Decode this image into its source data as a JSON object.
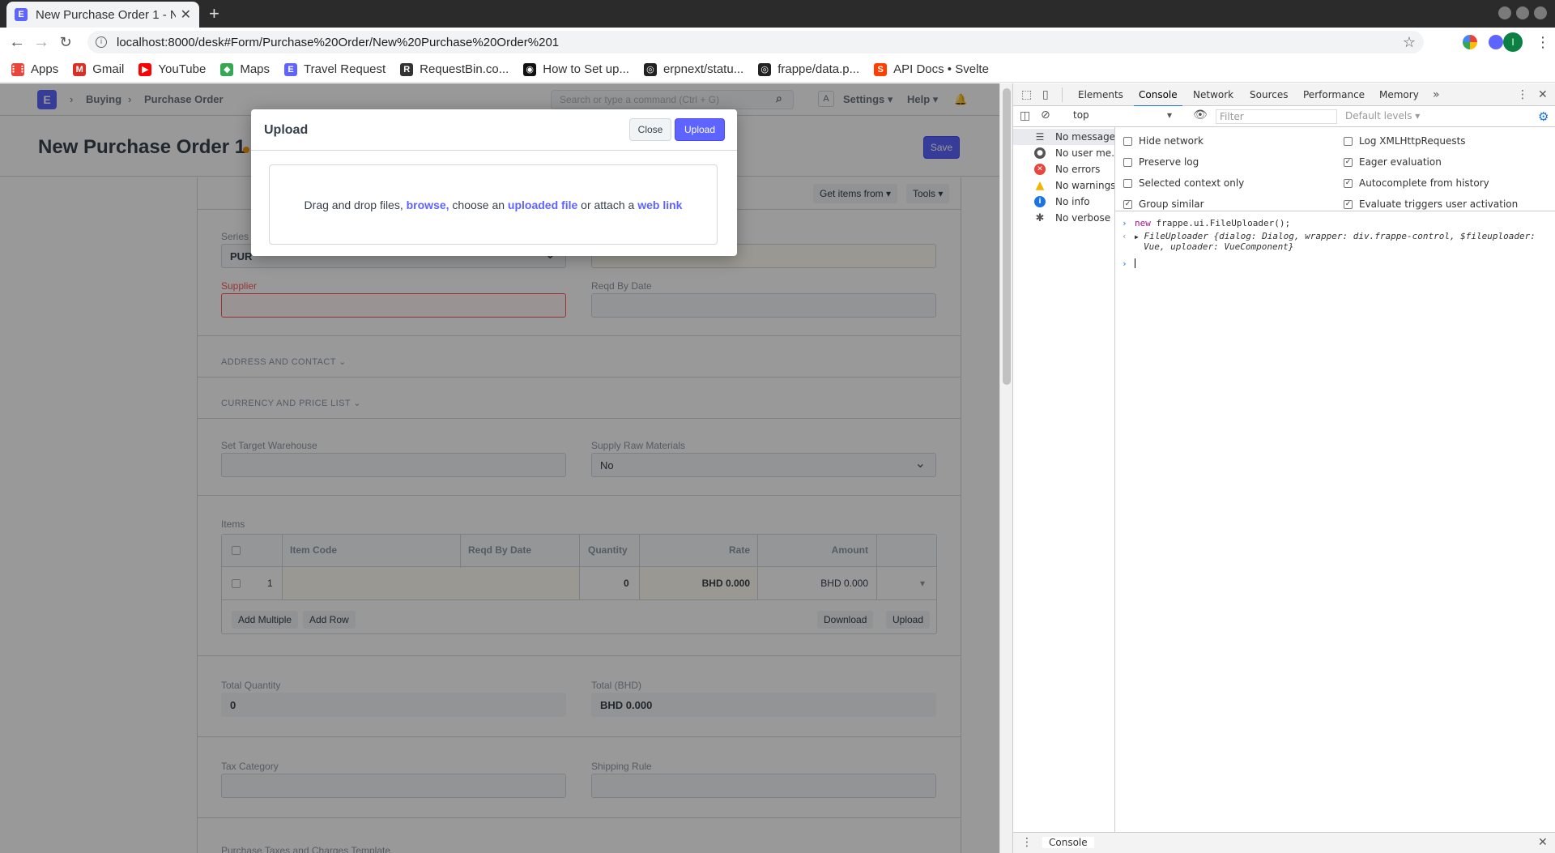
{
  "browser": {
    "tab_title": "New Purchase Order 1 - N",
    "favicon_letter": "E",
    "url": "localhost:8000/desk#Form/Purchase%20Order/New%20Purchase%20Order%201",
    "profile_initial": "I",
    "bookmarks": [
      {
        "label": "Apps",
        "icon": "apps-grid-icon",
        "color": "#e8453c"
      },
      {
        "label": "Gmail",
        "icon": "gmail-icon",
        "color": "#d93025"
      },
      {
        "label": "YouTube",
        "icon": "youtube-icon",
        "color": "#ff0000"
      },
      {
        "label": "Maps",
        "icon": "maps-icon",
        "color": "#34a853"
      },
      {
        "label": "Travel Request",
        "icon": "frappe-icon",
        "color": "#5e64ff"
      },
      {
        "label": "RequestBin.co...",
        "icon": "requestbin-icon",
        "color": "#333333"
      },
      {
        "label": "How to Set up...",
        "icon": "site-icon",
        "color": "#111111"
      },
      {
        "label": "erpnext/statu...",
        "icon": "github-icon",
        "color": "#222222"
      },
      {
        "label": "frappe/data.p...",
        "icon": "github-icon",
        "color": "#222222"
      },
      {
        "label": "API Docs • Svelte",
        "icon": "svelte-icon",
        "color": "#ff3e00"
      }
    ]
  },
  "app": {
    "logo_letter": "E",
    "breadcrumbs": [
      "Buying",
      "Purchase Order"
    ],
    "search_placeholder": "Search or type a command (Ctrl + G)",
    "avatar_letter": "A",
    "settings_label": "Settings",
    "help_label": "Help",
    "page_title": "New Purchase Order 1",
    "save_label": "Save",
    "toolbar": {
      "get_items": "Get items from",
      "tools": "Tools"
    }
  },
  "form": {
    "series_label": "Series",
    "series_value": "PUR",
    "supplier_label": "Supplier",
    "reqd_by_date_label": "Reqd By Date",
    "address_section": "ADDRESS AND CONTACT",
    "currency_section": "CURRENCY AND PRICE LIST",
    "target_warehouse_label": "Set Target Warehouse",
    "supply_raw_label": "Supply Raw Materials",
    "supply_raw_value": "No",
    "items_label": "Items",
    "items_columns": [
      "Item Code",
      "Reqd By Date",
      "Quantity",
      "Rate",
      "Amount"
    ],
    "items_row": {
      "idx": "1",
      "quantity": "0",
      "rate": "BHD 0.000",
      "amount": "BHD 0.000"
    },
    "items_buttons": {
      "add_multiple": "Add Multiple",
      "add_row": "Add Row",
      "download": "Download",
      "upload": "Upload"
    },
    "total_qty_label": "Total Quantity",
    "total_qty_value": "0",
    "total_label": "Total (BHD)",
    "total_value": "BHD 0.000",
    "tax_category_label": "Tax Category",
    "shipping_rule_label": "Shipping Rule",
    "taxes_template_label": "Purchase Taxes and Charges Template"
  },
  "dialog": {
    "title": "Upload",
    "close_label": "Close",
    "upload_label": "Upload",
    "drop_text_1": "Drag and drop files, ",
    "browse": "browse,",
    "drop_text_2": " choose an ",
    "uploaded_file": "uploaded file",
    "drop_text_3": " or attach a ",
    "web_link": "web link"
  },
  "devtools": {
    "tabs": [
      "Elements",
      "Console",
      "Network",
      "Sources",
      "Performance",
      "Memory"
    ],
    "active_tab": "Console",
    "context": "top",
    "filter_placeholder": "Filter",
    "levels": "Default levels",
    "sidebar": [
      {
        "label": "No messages",
        "icon": "list-icon"
      },
      {
        "label": "No user me...",
        "icon": "user-icon"
      },
      {
        "label": "No errors",
        "icon": "error-icon"
      },
      {
        "label": "No warnings",
        "icon": "warning-icon"
      },
      {
        "label": "No info",
        "icon": "info-icon"
      },
      {
        "label": "No verbose",
        "icon": "bug-icon"
      }
    ],
    "options_left": [
      {
        "label": "Hide network",
        "checked": false
      },
      {
        "label": "Preserve log",
        "checked": false
      },
      {
        "label": "Selected context only",
        "checked": false
      },
      {
        "label": "Group similar",
        "checked": true
      }
    ],
    "options_right": [
      {
        "label": "Log XMLHttpRequests",
        "checked": false
      },
      {
        "label": "Eager evaluation",
        "checked": true
      },
      {
        "label": "Autocomplete from history",
        "checked": true
      },
      {
        "label": "Evaluate triggers user activation",
        "checked": true
      }
    ],
    "console_input_kw": "new",
    "console_input_rest": " frappe.ui.FileUploader();",
    "console_output_1": "FileUploader {dialog: Dialog, wrapper: div.frappe-control, $fileuploader:",
    "console_output_2": "Vue, uploader: VueComponent}",
    "drawer_tab": "Console"
  }
}
